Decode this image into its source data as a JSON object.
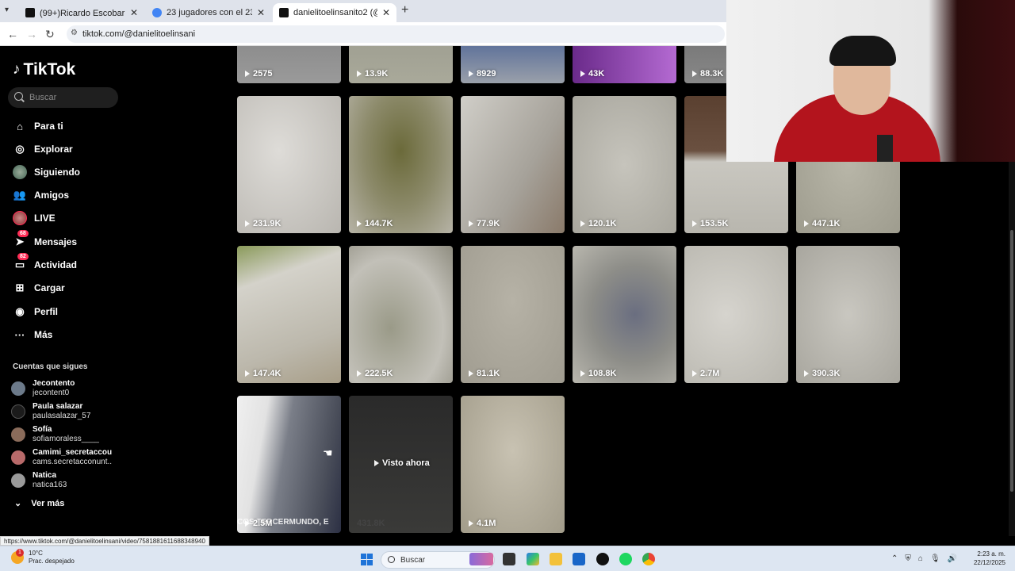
{
  "browser": {
    "tabs": [
      {
        "title": "(99+)Ricardo Escobar 🎨 (@ric",
        "active": false
      },
      {
        "title": "23 jugadores con el 23 - Buscar",
        "active": false
      },
      {
        "title": "danielitoelinsanito2 (@danielit",
        "active": true
      }
    ],
    "url": "tiktok.com/@danielitoelinsani",
    "status_url": "https://www.tiktok.com/@danielitoelinsani/video/7581881611688348940"
  },
  "sidebar": {
    "logo": "TikTok",
    "search_placeholder": "Buscar",
    "menu": [
      {
        "label": "Para ti",
        "icon": "home-icon"
      },
      {
        "label": "Explorar",
        "icon": "compass-icon"
      },
      {
        "label": "Siguiendo",
        "icon": "avatar-icon"
      },
      {
        "label": "Amigos",
        "icon": "friends-icon"
      },
      {
        "label": "LIVE",
        "icon": "live-icon"
      },
      {
        "label": "Mensajes",
        "icon": "paper-plane-icon",
        "badge": "68"
      },
      {
        "label": "Actividad",
        "icon": "inbox-icon",
        "badge": "82"
      },
      {
        "label": "Cargar",
        "icon": "plus-square-icon"
      },
      {
        "label": "Perfil",
        "icon": "person-icon"
      },
      {
        "label": "Más",
        "icon": "more-dots-icon"
      }
    ],
    "following_title": "Cuentas que sigues",
    "following": [
      {
        "name": "Jecontento",
        "handle": "jecontent0"
      },
      {
        "name": "Paula salazar",
        "handle": "paulasalazar_57"
      },
      {
        "name": "Sofía",
        "handle": "sofiamoraless____"
      },
      {
        "name": "Camimi_secretaccou...",
        "handle": "cams.secretacconunt..."
      },
      {
        "name": "Natica",
        "handle": "natica163"
      }
    ],
    "see_more": "Ver más"
  },
  "grid": {
    "rows": [
      [
        "2575",
        "13.9K",
        "8929",
        "43K",
        "88.3K"
      ],
      [
        "231.9K",
        "144.7K",
        "77.9K",
        "120.1K",
        "153.5K",
        "447.1K"
      ],
      [
        "147.4K",
        "222.5K",
        "81.1K",
        "108.8K",
        "2.7M",
        "390.3K"
      ],
      [
        "2.5M",
        "431.8K",
        "4.1M"
      ]
    ],
    "visto_ahora": "Visto ahora",
    "overlay_text": "COS TERCERMUNDO, E"
  },
  "taskbar": {
    "weather_temp": "10°C",
    "weather_desc": "Prac. despejado",
    "weather_alert": "1",
    "search_placeholder": "Buscar",
    "time": "2:23 a. m.",
    "date": "22/12/2025"
  }
}
